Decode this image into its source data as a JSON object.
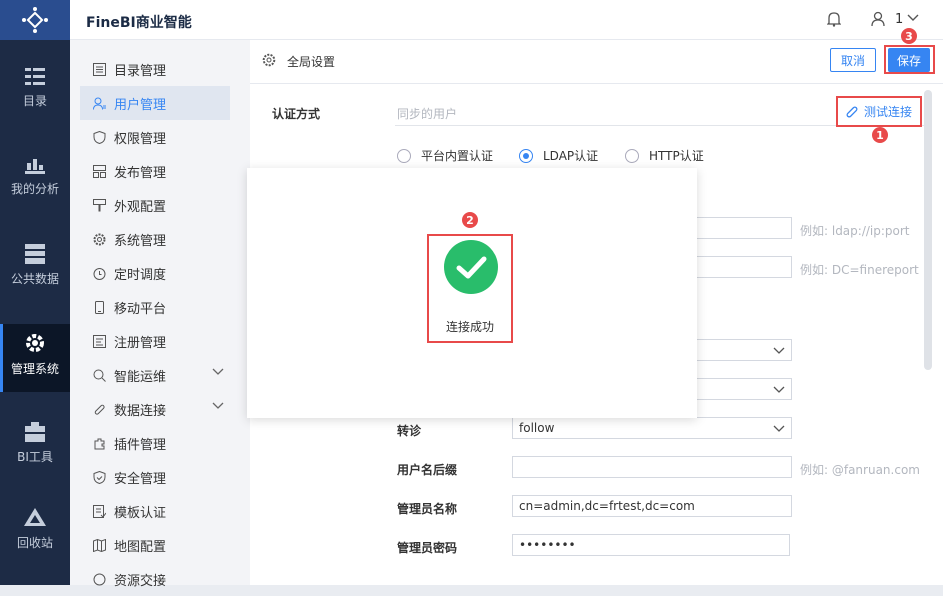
{
  "app": {
    "title": "FineBI商业智能",
    "user": "1"
  },
  "leftnav": [
    {
      "label": "目录",
      "icon": "catalog-icon"
    },
    {
      "label": "我的分析",
      "icon": "analysis-icon"
    },
    {
      "label": "公共数据",
      "icon": "public-data-icon"
    },
    {
      "label": "管理系统",
      "icon": "gear-icon"
    },
    {
      "label": "BI工具",
      "icon": "toolbox-icon"
    },
    {
      "label": "回收站",
      "icon": "recycle-icon"
    }
  ],
  "menu": [
    {
      "label": "目录管理"
    },
    {
      "label": "用户管理"
    },
    {
      "label": "权限管理"
    },
    {
      "label": "发布管理"
    },
    {
      "label": "外观配置"
    },
    {
      "label": "系统管理"
    },
    {
      "label": "定时调度"
    },
    {
      "label": "移动平台"
    },
    {
      "label": "注册管理"
    },
    {
      "label": "智能运维"
    },
    {
      "label": "数据连接"
    },
    {
      "label": "插件管理"
    },
    {
      "label": "安全管理"
    },
    {
      "label": "模板认证"
    },
    {
      "label": "地图配置"
    },
    {
      "label": "资源交接"
    }
  ],
  "header": {
    "title": "全局设置",
    "cancel": "取消",
    "save": "保存"
  },
  "form": {
    "auth_label": "认证方式",
    "sync_placeholder": "同步的用户",
    "test_connection": "测试连接",
    "radios": [
      "平台内置认证",
      "LDAP认证",
      "HTTP认证"
    ],
    "hint_url": "例如: ldap://ip:port",
    "hint_dc": "例如: DC=finereport",
    "referral_label": "转诊",
    "referral_value": "follow",
    "suffix_label": "用户名后缀",
    "suffix_hint": "例如: @fanruan.com",
    "admin_label": "管理员名称",
    "admin_value": "cn=admin,dc=frtest,dc=com",
    "password_label": "管理员密码",
    "password_value": "••••••••"
  },
  "modal": {
    "message": "连接成功"
  },
  "badges": {
    "one": "1",
    "two": "2",
    "three": "3"
  },
  "colors": {
    "accent": "#3685f2",
    "success": "#29bd6b",
    "highlight": "#e84a4a",
    "nav_bg": "#1d2b45"
  }
}
